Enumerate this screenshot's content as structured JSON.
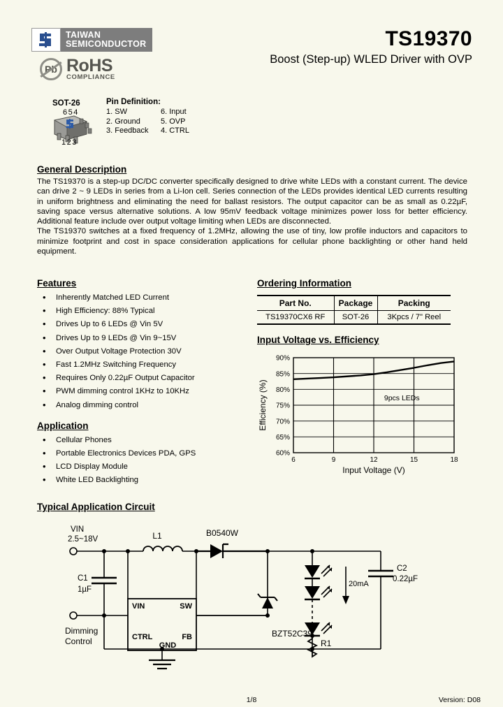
{
  "company": {
    "name_line1": "TAIWAN",
    "name_line2": "SEMICONDUCTOR",
    "mark_letters": "TS",
    "rohs_main": "RoHS",
    "rohs_sub": "COMPLIANCE",
    "rohs_pb": "Pb"
  },
  "header": {
    "part_number": "TS19370",
    "subtitle": "Boost (Step-up) WLED Driver with OVP"
  },
  "package": {
    "name": "SOT-26",
    "pins_top": "654",
    "pins_bottom": "123",
    "pin_definition_title": "Pin Definition:",
    "pins": [
      {
        "left": "1. SW",
        "right": "6. Input"
      },
      {
        "left": "2. Ground",
        "right": "5. OVP"
      },
      {
        "left": "3. Feedback",
        "right": "4. CTRL"
      }
    ]
  },
  "general_description": {
    "heading": "General Description",
    "paragraphs": [
      "The TS19370 is a step-up DC/DC converter specifically designed to drive white LEDs with a constant current. The device can drive 2 ~ 9 LEDs in series from a Li-Ion cell. Series connection of the LEDs provides identical LED currents resulting in uniform brightness and eliminating the need for ballast resistors. The output capacitor can be as small as 0.22µF, saving space versus alternative solutions. A low 95mV feedback voltage minimizes power loss for better efficiency. Additional feature include over output voltage limiting when LEDs are disconnected.",
      "The TS19370 switches at a fixed frequency of 1.2MHz, allowing the use of tiny, low profile inductors and capacitors to minimize footprint and cost in space consideration applications for cellular phone backlighting or other hand held equipment."
    ]
  },
  "features": {
    "heading": "Features",
    "items": [
      "Inherently Matched LED Current",
      "High Efficiency: 88% Typical",
      "Drives Up to 6 LEDs @ Vin 5V",
      "Drives Up to 9 LEDs @ Vin 9~15V",
      "Over Output Voltage Protection 30V",
      "Fast 1.2MHz Switching Frequency",
      "Requires Only 0.22µF Output Capacitor",
      "PWM dimming control 1KHz to 10KHz",
      "Analog dimming control"
    ]
  },
  "application": {
    "heading": "Application",
    "items": [
      "Cellular Phones",
      "Portable Electronics Devices PDA, GPS",
      "LCD Display Module",
      "White LED Backlighting"
    ]
  },
  "ordering": {
    "heading": "Ordering Information",
    "columns": [
      "Part No.",
      "Package",
      "Packing"
    ],
    "rows": [
      [
        "TS19370CX6 RF",
        "SOT-26",
        "3Kpcs / 7\" Reel"
      ]
    ]
  },
  "chart_section": {
    "heading": "Input Voltage vs. Efficiency"
  },
  "chart_data": {
    "type": "line",
    "title": "Input Voltage vs. Efficiency",
    "xlabel": "Input Voltage (V)",
    "ylabel": "Efficiency (%)",
    "xlim": [
      6,
      18
    ],
    "ylim": [
      60,
      90
    ],
    "xticks": [
      "6",
      "9",
      "12",
      "15",
      "18"
    ],
    "yticks": [
      "60%",
      "65%",
      "70%",
      "75%",
      "80%",
      "85%",
      "90%"
    ],
    "grid": true,
    "legend": "none",
    "annotations": [
      "9pcs LEDs"
    ],
    "series": [
      {
        "name": "9pcs LEDs",
        "x": [
          6,
          7,
          8,
          9,
          10,
          11,
          12,
          13,
          14,
          15,
          16,
          17,
          18
        ],
        "y": [
          83.2,
          83.4,
          83.6,
          83.8,
          84.1,
          84.4,
          84.8,
          85.4,
          86.1,
          86.8,
          87.6,
          88.3,
          88.8
        ]
      }
    ]
  },
  "circuit": {
    "heading": "Typical Application Circuit",
    "labels": {
      "vin": "VIN",
      "vin_range": "2.5~18V",
      "c1": "C1",
      "c1_val": "1µF",
      "l1": "L1",
      "diode": "B0540W",
      "c2": "C2",
      "c2_val": "0.22µF",
      "led_current": "20mA",
      "zener": "BZT52C39",
      "r1": "R1",
      "ic_vin": "VIN",
      "ic_sw": "SW",
      "ic_ctrl": "CTRL",
      "ic_fb": "FB",
      "ic_gnd": "GND",
      "dimming_line1": "Dimming",
      "dimming_line2": "Control"
    }
  },
  "footer": {
    "page": "1/8",
    "version": "Version: D08"
  },
  "colors": {
    "background": "#f8f8ec",
    "logo_banner": "#7d7d7d",
    "logo_mark": "#2a4f8f",
    "rohs_gray": "#55554f",
    "package_body": "#8a8a86"
  }
}
